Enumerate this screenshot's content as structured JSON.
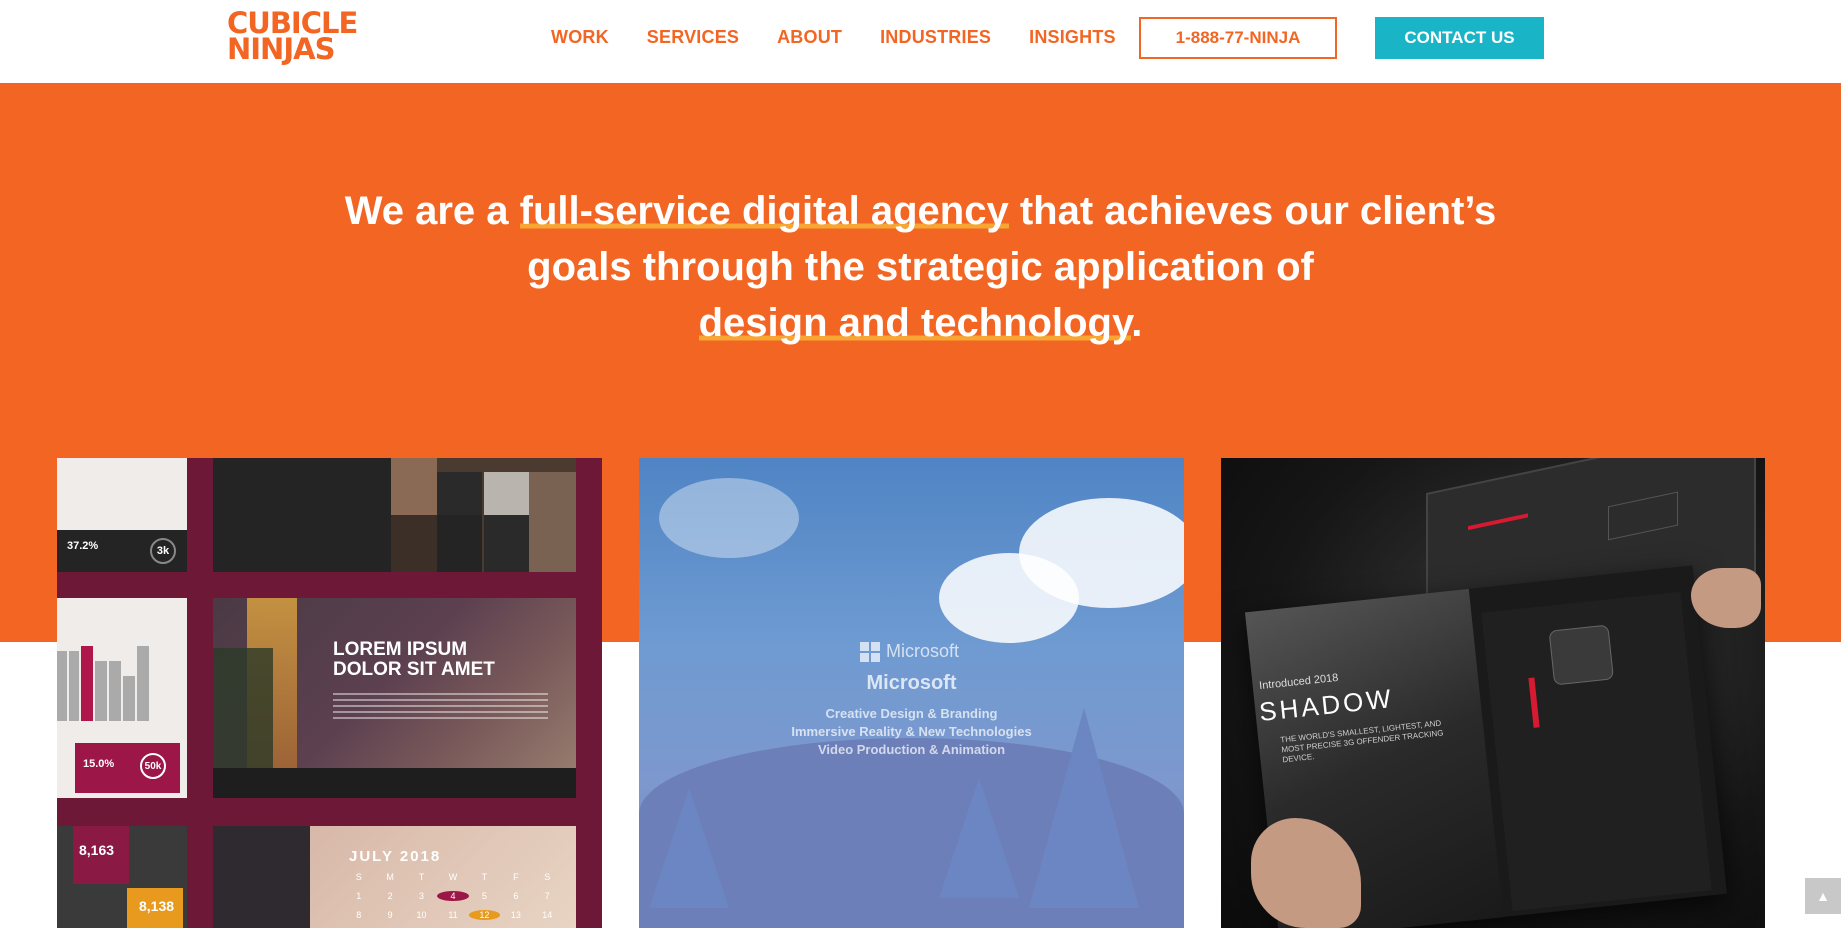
{
  "nav": {
    "logo_line1": "CUBICLE",
    "logo_line2": "NINJAS",
    "items": [
      {
        "label": "WORK"
      },
      {
        "label": "SERVICES"
      },
      {
        "label": "ABOUT"
      },
      {
        "label": "INDUSTRIES"
      },
      {
        "label": "INSIGHTS"
      }
    ],
    "phone": "1-888-77-NINJA",
    "contact": "CONTACT US"
  },
  "hero": {
    "part1": "We are a ",
    "highlight1": "full-service digital agency",
    "part2": " that achieves our client’s",
    "line2": "goals through the strategic application of",
    "highlight2": "design and technology",
    "end": "."
  },
  "card1": {
    "stat1": "37.2%",
    "stat2": "3k",
    "stat3": "15.0%",
    "stat4": "50k",
    "headline_l1": "LOREM IPSUM",
    "headline_l2": "DOLOR SIT AMET",
    "count1": "8,163",
    "count2": "8,138",
    "calendar_title": "JULY 2018",
    "weekdays": [
      "S",
      "M",
      "T",
      "W",
      "T",
      "F",
      "S"
    ],
    "days": [
      "1",
      "2",
      "3",
      "4",
      "5",
      "6",
      "7",
      "8",
      "9",
      "10",
      "11",
      "12",
      "13",
      "14"
    ]
  },
  "card2": {
    "brand": "Microsoft",
    "title": "Microsoft",
    "lines": [
      "Creative Design & Branding",
      "Immersive Reality & New Technologies",
      "Video Production & Animation"
    ]
  },
  "card3": {
    "kicker": "Introduced 2018",
    "product": "SHADOW",
    "tagline": "THE WORLD'S SMALLEST, LIGHTEST, AND MOST PRECISE 3G OFFENDER TRACKING DEVICE."
  },
  "colors": {
    "brand_orange": "#f26522",
    "accent_teal": "#19b5c6",
    "highlight_yellow": "#f7a633"
  }
}
